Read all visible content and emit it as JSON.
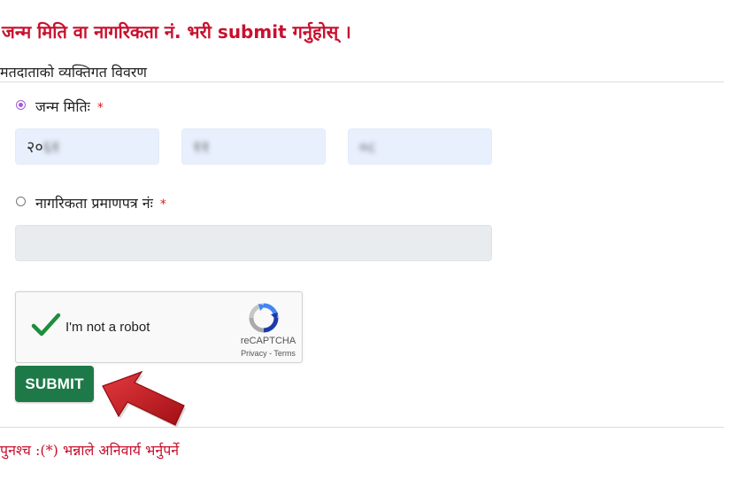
{
  "page": {
    "title": "जन्म मिति वा नागरिकता नं. भरी submit गर्नुहोस् ।"
  },
  "section": {
    "heading": "मतदाताको व्यक्तिगत विवरण"
  },
  "dob": {
    "label": "जन्म मितिः",
    "required_mark": "*",
    "selected": true,
    "year_value": "२०",
    "year_blurred": "६१",
    "month_value": "११",
    "day_value": "०८"
  },
  "citizenship": {
    "label": "नागरिकता प्रमाणपत्र नंः",
    "required_mark": "*",
    "selected": false,
    "value": ""
  },
  "captcha": {
    "checkbox_label": "I'm not a robot",
    "checked": true,
    "brand": "reCAPTCHA",
    "privacy_link": "Privacy",
    "separator": " - ",
    "terms_link": "Terms"
  },
  "form": {
    "submit_label": "SUBMIT"
  },
  "footer": {
    "note": "पुनश्च :(*) भन्नाले अनिवार्य भर्नुपर्ने"
  },
  "colors": {
    "title_red": "#c8102e",
    "submit_green": "#1d7a48",
    "input_bg": "#e8f0fe",
    "disabled_input_bg": "#e9ecef",
    "arrow_red": "#c4161c"
  }
}
